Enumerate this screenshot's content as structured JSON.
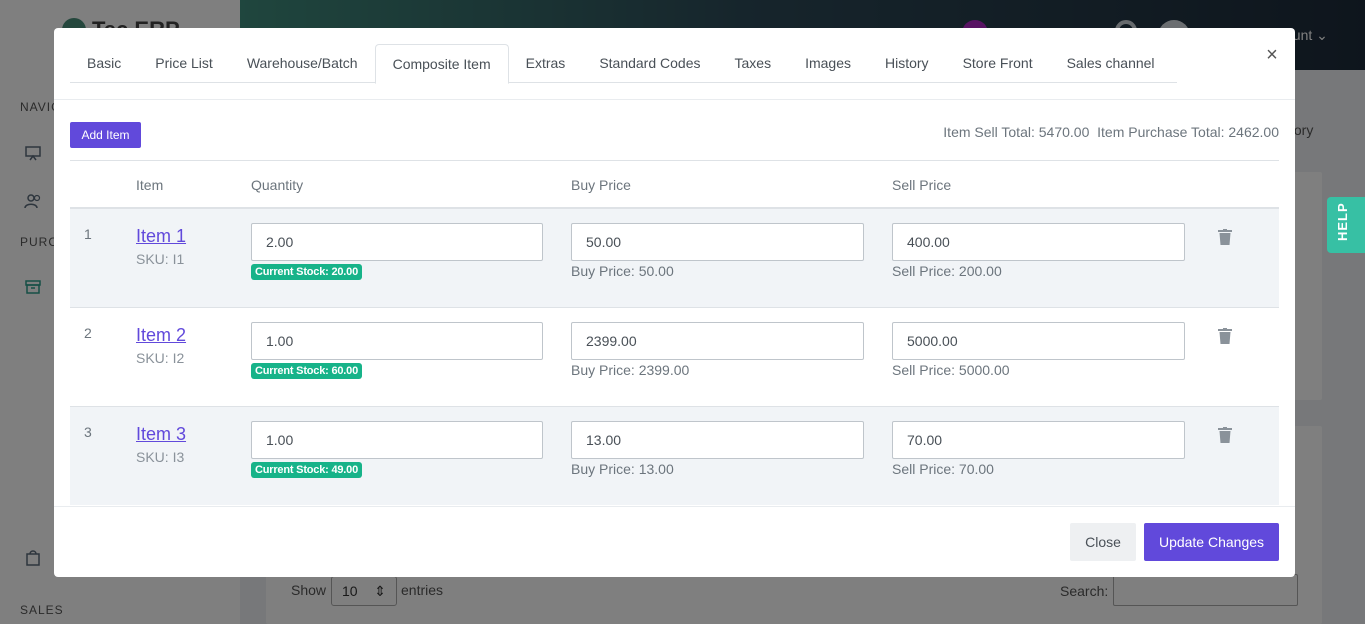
{
  "app": {
    "logo_text": "Tec ERP",
    "account_label": "count",
    "help_label": "HELP",
    "side_sections": [
      "NAVIG",
      "PURCH",
      "SALES"
    ],
    "bg_history_label": "tory",
    "bg_show_label": "Show",
    "bg_entries_value": "10",
    "bg_entries_label": "entries",
    "bg_search_label": "Search:"
  },
  "modal": {
    "tabs": [
      {
        "label": "Basic"
      },
      {
        "label": "Price List"
      },
      {
        "label": "Warehouse/Batch"
      },
      {
        "label": "Composite Item",
        "active": true
      },
      {
        "label": "Extras"
      },
      {
        "label": "Standard Codes"
      },
      {
        "label": "Taxes"
      },
      {
        "label": "Images"
      },
      {
        "label": "History"
      },
      {
        "label": "Store Front"
      },
      {
        "label": "Sales channel"
      }
    ],
    "close_symbol": "×",
    "add_item_label": "Add Item",
    "sell_total_label": "Item Sell Total: 5470.00",
    "purchase_total_label": "Item Purchase Total: 2462.00",
    "columns": {
      "item": "Item",
      "quantity": "Quantity",
      "buy_price": "Buy Price",
      "sell_price": "Sell Price"
    },
    "rows": [
      {
        "num": "1",
        "name": "Item 1",
        "sku": "SKU: I1",
        "quantity": "2.00",
        "stock": "Current Stock: 20.00",
        "buy": "50.00",
        "buy_hint": "Buy Price: 50.00",
        "sell": "400.00",
        "sell_hint": "Sell Price: 200.00"
      },
      {
        "num": "2",
        "name": "Item 2",
        "sku": "SKU: I2",
        "quantity": "1.00",
        "stock": "Current Stock: 60.00",
        "buy": "2399.00",
        "buy_hint": "Buy Price: 2399.00",
        "sell": "5000.00",
        "sell_hint": "Sell Price: 5000.00"
      },
      {
        "num": "3",
        "name": "Item 3",
        "sku": "SKU: I3",
        "quantity": "1.00",
        "stock": "Current Stock: 49.00",
        "buy": "13.00",
        "buy_hint": "Buy Price: 13.00",
        "sell": "70.00",
        "sell_hint": "Sell Price: 70.00"
      }
    ],
    "close_label": "Close",
    "update_label": "Update Changes"
  },
  "colors": {
    "primary": "#6149db",
    "badge": "#17b389",
    "help": "#37c0a4"
  }
}
